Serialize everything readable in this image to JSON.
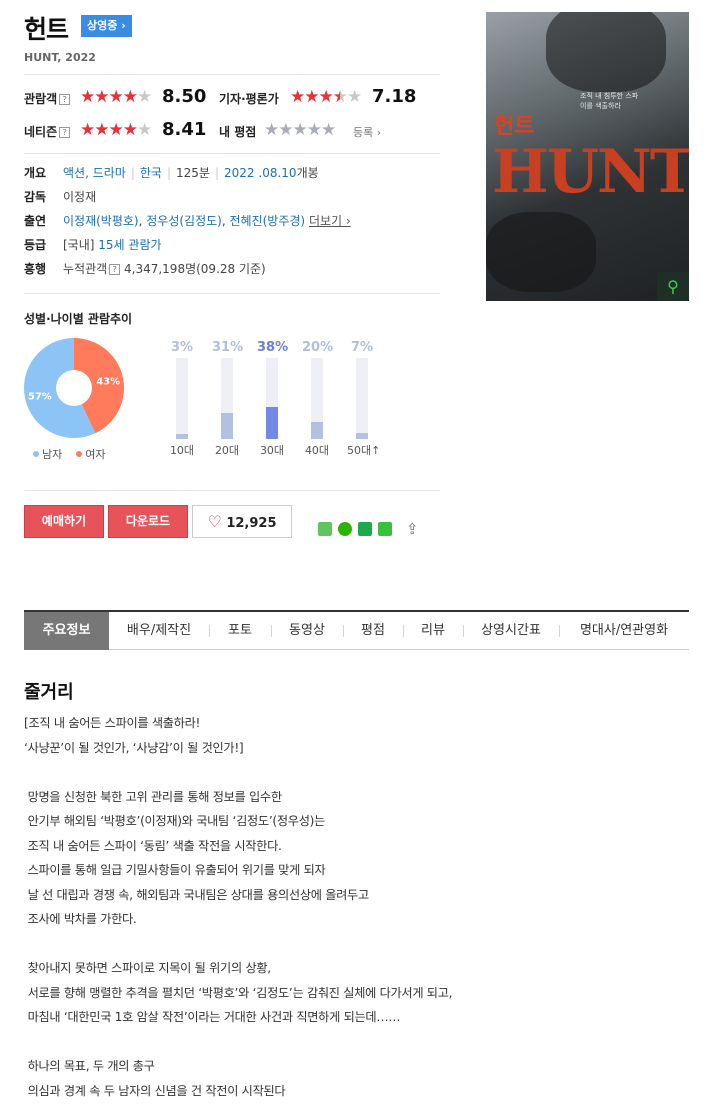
{
  "header": {
    "title": "헌트",
    "status_badge": "상영중 ›",
    "subtitle": "HUNT, 2022"
  },
  "ratings": {
    "audience_label": "관람객",
    "audience_score": "8.50",
    "critic_label": "기자·평론가",
    "critic_score": "7.18",
    "netizen_label": "네티즌",
    "netizen_score": "8.41",
    "my_label": "내 평점",
    "my_register": "등록 ›",
    "help_mark": "?"
  },
  "info": {
    "overview_label": "개요",
    "genre": "액션, 드라마",
    "country": "한국",
    "runtime": "125분",
    "release_date": "2022 .08.10",
    "release_suffix": "개봉",
    "director_label": "감독",
    "director": "이정재",
    "cast_label": "출연",
    "cast_1": "이정재(박평호)",
    "cast_2": "정우성(김정도)",
    "cast_3": "전혜진(방주경)",
    "cast_more": "더보기 ›",
    "rating_label": "등급",
    "rating_prefix": "[국내]",
    "rating_value": "15세 관람가",
    "boxoffice_label": "흥행",
    "boxoffice_text": "누적관객",
    "boxoffice_value": "4,347,198명(09.28 기준)"
  },
  "poster": {
    "title_ko": "헌트",
    "title_en": "HUNT",
    "tagline": "조직 내 침투한 스파이를 색출하라"
  },
  "chart_title": "성별·나이별 관람추이",
  "legend": {
    "male": "남자",
    "female": "여자"
  },
  "chart_data": [
    {
      "type": "pie",
      "categories": [
        "남자",
        "여자"
      ],
      "values": [
        57,
        43
      ],
      "labels": [
        "57%",
        "43%"
      ],
      "colors": [
        "#8cc4f5",
        "#ff7b5c"
      ]
    },
    {
      "type": "bar",
      "categories": [
        "10대",
        "20대",
        "30대",
        "40대",
        "50대↑"
      ],
      "values": [
        3,
        31,
        38,
        20,
        7
      ],
      "labels": [
        "3%",
        "31%",
        "38%",
        "20%",
        "7%"
      ],
      "ylim": [
        0,
        100
      ]
    }
  ],
  "buttons": {
    "reserve": "예매하기",
    "download": "다운로드",
    "like_count": "12,925",
    "heart_icon": "♡",
    "share_icon": "⇪"
  },
  "tabs": [
    "주요정보",
    "배우/제작진",
    "포토",
    "동영상",
    "평점",
    "리뷰",
    "상영시간표",
    "명대사/연관영화"
  ],
  "synopsis": {
    "title": "줄거리",
    "text": "[조직 내 숨어든 스파이를 색출하라!\n‘사냥꾼’이 될 것인가, ‘사냥감’이 될 것인가!]\n\n 망명을 신청한 북한 고위 관리를 통해 정보를 입수한\n 안기부 해외팀 ‘박평호’(이정재)와 국내팀 ‘김정도’(정우성)는\n 조직 내 숨어든 스파이 ‘동림’ 색출 작전을 시작한다.\n 스파이를 통해 일급 기밀사항들이 유출되어 위기를 맞게 되자\n 날 선 대립과 경쟁 속, 해외팀과 국내팀은 상대를 용의선상에 올려두고\n 조사에 박차를 가한다.\n\n 찾아내지 못하면 스파이로 지목이 될 위기의 상황,\n 서로를 향해 맹렬한 추격을 펼치던 ‘박평호’와 ‘김정도’는 감춰진 실체에 다가서게 되고,\n 마침내 ‘대한민국 1호 암살 작전’이라는 거대한 사건과 직면하게 되는데……\n\n 하나의 목표, 두 개의 총구\n 의심과 경계 속 두 남자의 신념을 건 작전이 시작된다"
  }
}
